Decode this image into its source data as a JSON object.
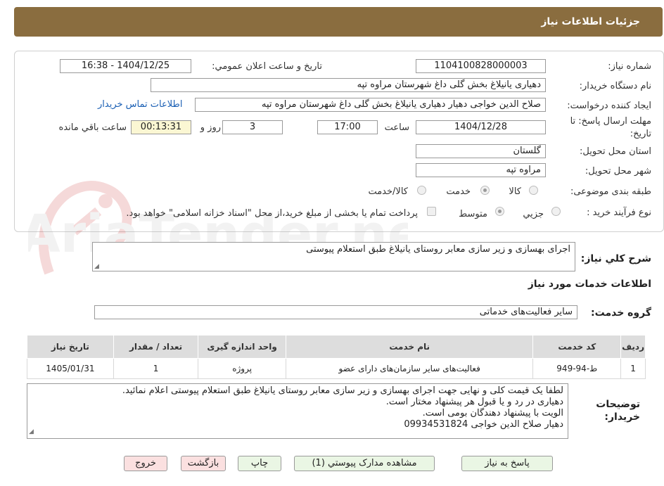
{
  "header": {
    "title": "جزئیات اطلاعات نیاز"
  },
  "form": {
    "need_number": {
      "label": "شماره نیاز:",
      "value": "1104100828000003"
    },
    "announce_datetime": {
      "label": "تاریخ و ساعت اعلان عمومي:",
      "value": "1404/12/25 - 16:38"
    },
    "buyer_org": {
      "label": "نام دستگاه خریدار:",
      "value": "دهیاری یانیلاغ بخش گلی داغ شهرستان مراوه تپه"
    },
    "requester": {
      "label": "ایجاد کننده درخواست:",
      "value": "صلاح الدین خواجی دهیار دهیاری یانیلاغ بخش گلی داغ شهرستان مراوه تپه"
    },
    "contact_link": "اطلاعات تماس خریدار",
    "deadline": {
      "label_line1": "مهلت ارسال پاسخ: تا",
      "label_line2": "تاریخ:",
      "date": "1404/12/28",
      "time_label": "ساعت",
      "time": "17:00",
      "days": "3",
      "days_label": "روز و",
      "remaining": "00:13:31",
      "remaining_label": "ساعت باقي مانده"
    },
    "province": {
      "label": "استان محل تحویل:",
      "value": "گلستان"
    },
    "city": {
      "label": "شهر محل تحویل:",
      "value": "مراوه تپه"
    },
    "category": {
      "label": "طبقه بندی موضوعی:",
      "options": [
        "کالا",
        "خدمت",
        "کالا/خدمت"
      ],
      "selected": "خدمت"
    },
    "process": {
      "label": "نوع فرآیند خرید :",
      "options": [
        "جزيي",
        "متوسط"
      ],
      "selected": "متوسط",
      "payment_note": "پرداخت تمام یا بخشی از مبلغ خرید،از محل \"اسناد خزانه اسلامی\" خواهد بود."
    }
  },
  "description": {
    "label": "شرح كلي نياز:",
    "value": "اجرای بهسازی و زیر سازی معابر روستای یانیلاغ طبق استعلام پیوستی"
  },
  "services_section": {
    "title": "اطلاعات خدمات مورد نياز",
    "group_label": "گروه خدمت:",
    "group_value": "سایر فعالیت‌های خدماتی"
  },
  "table": {
    "headers": [
      "ردیف",
      "کد خدمت",
      "نام خدمت",
      "واحد اندازه گیری",
      "تعداد / مقدار",
      "تاریخ نیاز"
    ],
    "rows": [
      [
        "1",
        "ط-94-949",
        "فعالیت‌های سایر سازمان‌های دارای عضو",
        "پروژه",
        "1",
        "1405/01/31"
      ]
    ]
  },
  "buyer_notes": {
    "label_line1": "توضیحات",
    "label_line2": "خریدار:",
    "lines": [
      "لطفا یک قیمت کلی و نهایی جهت اجرای بهسازی و زیر سازی معابر روستای یانیلاغ طبق استعلام پیوستی اعلام نمائید.",
      "دهیاری در رد و یا قبول هر پیشنهاد مختار است.",
      "الویت با پیشنهاد دهندگان بومی است.",
      "دهیار صلاح الدین خواجی 09934531824"
    ]
  },
  "buttons": {
    "reply": "پاسخ به نیاز",
    "attachments": "مشاهده مدارک پیوستي (1)",
    "print": "چاپ",
    "back": "بازگشت",
    "exit": "خروج"
  },
  "watermark": {
    "text": "AriaTender.neT"
  },
  "colors": {
    "header_bg": "#8a6d3f",
    "link": "#1a5fb4",
    "button_green": "#eaf6e4",
    "button_red": "#fbe0e0",
    "table_header": "#dddddd"
  }
}
